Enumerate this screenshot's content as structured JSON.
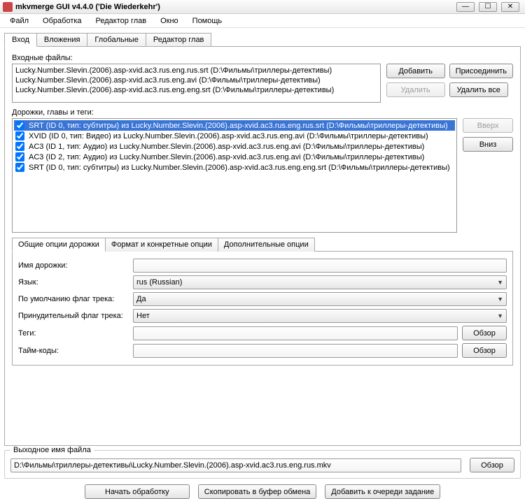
{
  "window": {
    "title": "mkvmerge GUI v4.4.0 ('Die Wiederkehr')"
  },
  "menu": {
    "file": "Файл",
    "mux": "Обработка",
    "chapters": "Редактор глав",
    "window": "Окно",
    "help": "Помощь"
  },
  "tabs": {
    "input": "Вход",
    "attachments": "Вложения",
    "global": "Глобальные",
    "chapter_editor": "Редактор глав"
  },
  "labels": {
    "input_files": "Входные файлы:",
    "tracks": "Дорожки, главы и теги:",
    "output_file": "Выходное имя файла",
    "track_name": "Имя дорожки:",
    "language": "Язык:",
    "default_flag": "По умолчанию флаг трека:",
    "forced_flag": "Принудительный флаг трека:",
    "tags": "Теги:",
    "timecodes": "Тайм-коды:"
  },
  "inner_tabs": {
    "general": "Общие опции дорожки",
    "format": "Формат и конкретные опции",
    "extra": "Дополнительные опции"
  },
  "buttons": {
    "add": "Добавить",
    "append": "Присоединить",
    "remove": "Удалить",
    "remove_all": "Удалить все",
    "up": "Вверх",
    "down": "Вниз",
    "browse": "Обзор",
    "start": "Начать обработку",
    "copy_clipboard": "Скопировать в буфер обмена",
    "add_queue": "Добавить к очереди задание"
  },
  "files": [
    "Lucky.Number.Slevin.(2006).asp-xvid.ac3.rus.eng.rus.srt (D:\\Фильмы\\триллеры-детективы)",
    "Lucky.Number.Slevin.(2006).asp-xvid.ac3.rus.eng.avi (D:\\Фильмы\\триллеры-детективы)",
    "Lucky.Number.Slevin.(2006).asp-xvid.ac3.rus.eng.eng.srt (D:\\Фильмы\\триллеры-детективы)"
  ],
  "tracks": [
    {
      "checked": true,
      "selected": true,
      "text": "SRT (ID 0, тип: субтитры) из Lucky.Number.Slevin.(2006).asp-xvid.ac3.rus.eng.rus.srt (D:\\Фильмы\\триллеры-детективы)"
    },
    {
      "checked": true,
      "selected": false,
      "text": "XVID (ID 0, тип: Видео) из Lucky.Number.Slevin.(2006).asp-xvid.ac3.rus.eng.avi (D:\\Фильмы\\триллеры-детективы)"
    },
    {
      "checked": true,
      "selected": false,
      "text": "AC3 (ID 1, тип: Аудио) из Lucky.Number.Slevin.(2006).asp-xvid.ac3.rus.eng.avi (D:\\Фильмы\\триллеры-детективы)"
    },
    {
      "checked": true,
      "selected": false,
      "text": "AC3 (ID 2, тип: Аудио) из Lucky.Number.Slevin.(2006).asp-xvid.ac3.rus.eng.avi (D:\\Фильмы\\триллеры-детективы)"
    },
    {
      "checked": true,
      "selected": false,
      "text": "SRT (ID 0, тип: субтитры) из Lucky.Number.Slevin.(2006).asp-xvid.ac3.rus.eng.eng.srt (D:\\Фильмы\\триллеры-детективы)"
    }
  ],
  "track_options": {
    "name": "",
    "language": "rus (Russian)",
    "default_flag": "Да",
    "forced_flag": "Нет",
    "tags": "",
    "timecodes": ""
  },
  "output_path": "D:\\Фильмы\\триллеры-детективы\\Lucky.Number.Slevin.(2006).asp-xvid.ac3.rus.eng.rus.mkv"
}
